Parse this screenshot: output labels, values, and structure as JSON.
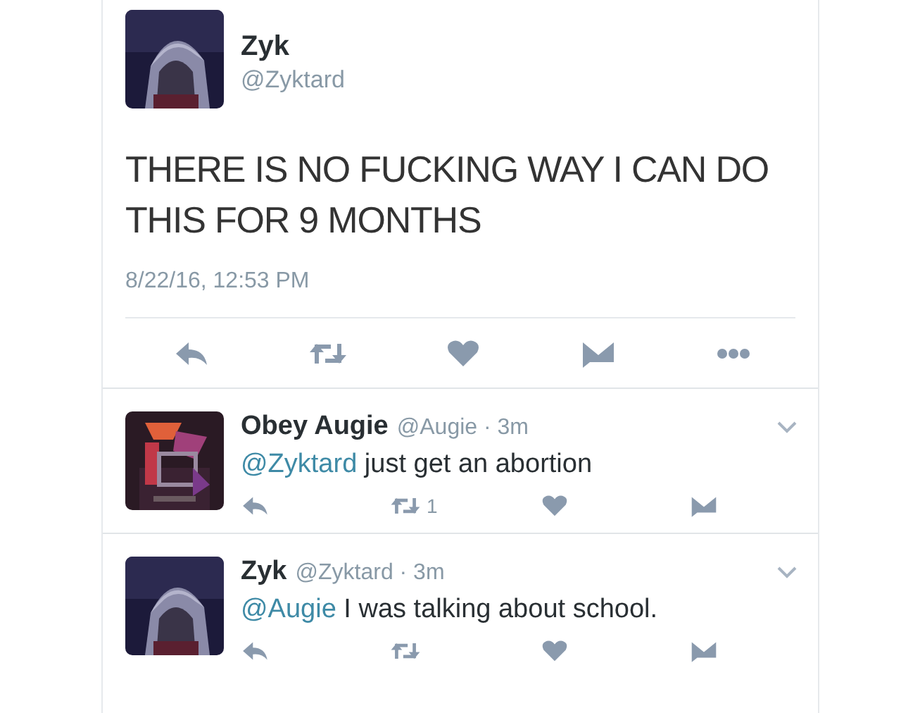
{
  "tweet": {
    "name": "Zyk",
    "handle": "@Zyktard",
    "avatar": {
      "kind": "picture"
    },
    "text": "THERE IS NO FUCKING WAY I CAN DO THIS FOR 9 MONTHS",
    "timestamp": "8/22/16, 12:53 PM",
    "actions": [
      {
        "kind": "reply"
      },
      {
        "kind": "retweet"
      },
      {
        "kind": "like"
      },
      {
        "kind": "message"
      },
      {
        "kind": "more"
      }
    ]
  },
  "replies": [
    {
      "name": "Obey Augie",
      "meta": "@Augie · 3m",
      "avatar": {
        "kind": "picture"
      },
      "mention": "@Zyktard",
      "text": "just get an abortion",
      "actions": [
        {
          "kind": "reply"
        },
        {
          "kind": "retweet",
          "count": "1"
        },
        {
          "kind": "like"
        },
        {
          "kind": "message"
        }
      ]
    },
    {
      "name": "Zyk",
      "meta": "@Zyktard · 3m",
      "avatar": {
        "kind": "picture"
      },
      "mention": "@Augie",
      "text": "I was talking about school.",
      "actions": [
        {
          "kind": "reply"
        },
        {
          "kind": "retweet"
        },
        {
          "kind": "like"
        },
        {
          "kind": "message"
        }
      ]
    }
  ]
}
